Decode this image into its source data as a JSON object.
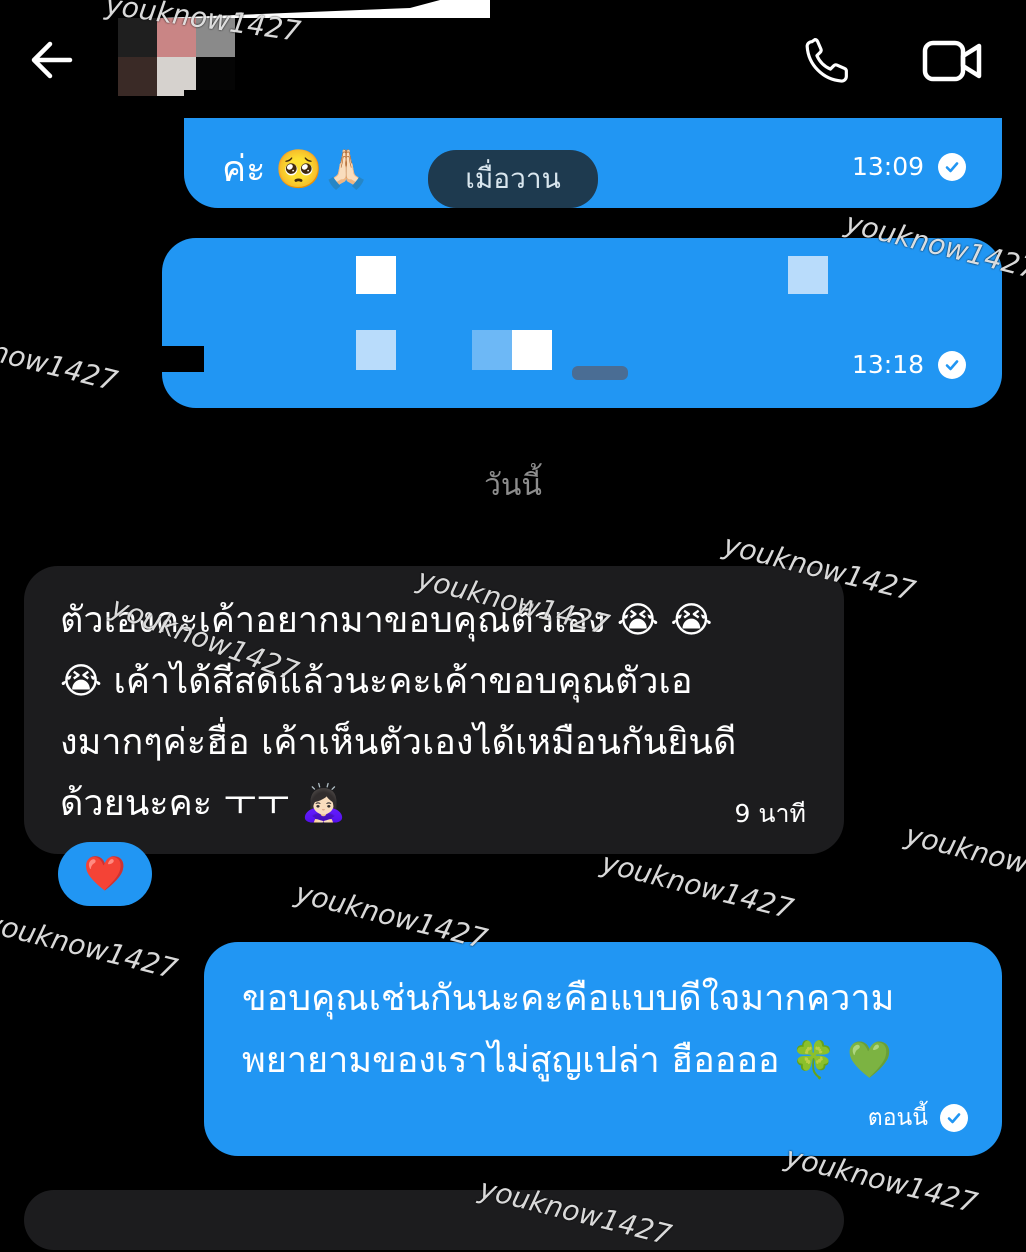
{
  "colors": {
    "outgoing": "#2196f3",
    "incoming": "#1c1c1e",
    "date_pill": "#1e3a4f",
    "background": "#000000"
  },
  "header": {
    "back_icon": "arrow-left-icon",
    "call_icon": "phone-icon",
    "video_icon": "video-camera-icon"
  },
  "messages": {
    "m1": {
      "text": "ค่ะ",
      "emojis": "🥺🙏🏻",
      "time": "13:09"
    },
    "date_yesterday": "เมื่อวาน",
    "m2": {
      "time": "13:18"
    },
    "date_today": "วันนี้",
    "m3": {
      "lines": [
        "ตัวเองคะเค้าอยากมาขอบคุณตัวเอง 😭 😭",
        "😭 เค้าได้สีสดแล้วนะคะเค้าขอบคุณตัวเอ",
        "งมากๆค่ะฮื่อ เค้าเห็นตัวเองได้เหมือนกันยินดี",
        "ด้วยนะคะ ㅜㅜ 🙇🏻‍♀️"
      ],
      "time": "9 นาที",
      "reaction": "❤️"
    },
    "m4": {
      "lines": [
        "ขอบคุณเช่นกันนะคะคือแบบดีใจมากความ",
        "พยายามของเราไม่สูญเปล่า ฮืออออ 🍀 💚"
      ],
      "time": "ตอนนี้"
    }
  },
  "watermark": "youknow1427"
}
